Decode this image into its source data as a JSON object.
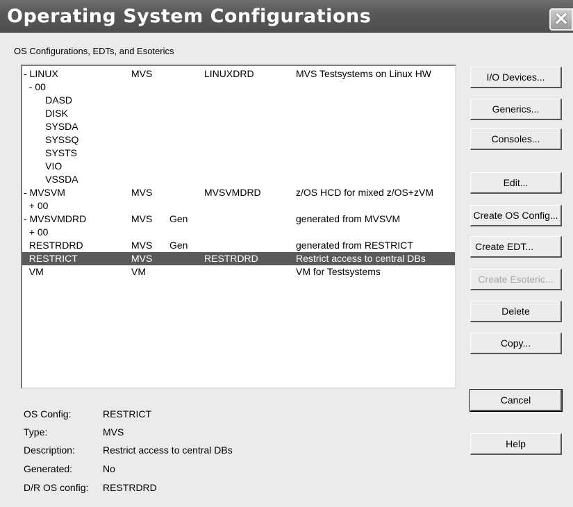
{
  "window": {
    "title": "Operating System Configurations",
    "close_glyph": "✕"
  },
  "group_label": "OS Configurations, EDTs, and Esoterics",
  "list": [
    {
      "name": "- LINUX",
      "type": "MVS",
      "gen": "",
      "dr": "LINUXDRD",
      "desc": "MVS Testsystems on Linux HW",
      "selected": false
    },
    {
      "name": "  - 00",
      "type": "",
      "gen": "",
      "dr": "",
      "desc": "",
      "selected": false
    },
    {
      "name": "        DASD",
      "type": "",
      "gen": "",
      "dr": "",
      "desc": "",
      "selected": false
    },
    {
      "name": "        DISK",
      "type": "",
      "gen": "",
      "dr": "",
      "desc": "",
      "selected": false
    },
    {
      "name": "        SYSDA",
      "type": "",
      "gen": "",
      "dr": "",
      "desc": "",
      "selected": false
    },
    {
      "name": "        SYSSQ",
      "type": "",
      "gen": "",
      "dr": "",
      "desc": "",
      "selected": false
    },
    {
      "name": "        SYSTS",
      "type": "",
      "gen": "",
      "dr": "",
      "desc": "",
      "selected": false
    },
    {
      "name": "        VIO",
      "type": "",
      "gen": "",
      "dr": "",
      "desc": "",
      "selected": false
    },
    {
      "name": "        VSSDA",
      "type": "",
      "gen": "",
      "dr": "",
      "desc": "",
      "selected": false
    },
    {
      "name": "- MVSVM",
      "type": "MVS",
      "gen": "",
      "dr": "MVSVMDRD",
      "desc": "z/OS HCD for mixed z/OS+zVM",
      "selected": false
    },
    {
      "name": "  + 00",
      "type": "",
      "gen": "",
      "dr": "",
      "desc": "",
      "selected": false
    },
    {
      "name": "- MVSVMDRD",
      "type": "MVS",
      "gen": "Gen",
      "dr": "",
      "desc": "generated from MVSVM",
      "selected": false
    },
    {
      "name": "  + 00",
      "type": "",
      "gen": "",
      "dr": "",
      "desc": "",
      "selected": false
    },
    {
      "name": "  RESTRDRD",
      "type": "MVS",
      "gen": "Gen",
      "dr": "",
      "desc": "generated from RESTRICT",
      "selected": false
    },
    {
      "name": "  RESTRICT",
      "type": "MVS",
      "gen": "",
      "dr": "RESTRDRD",
      "desc": "Restrict access to central DBs",
      "selected": true
    },
    {
      "name": "  VM",
      "type": "VM",
      "gen": "",
      "dr": "",
      "desc": "VM for Testsystems",
      "selected": false
    }
  ],
  "buttons": {
    "io_devices": "I/O Devices...",
    "generics": "Generics...",
    "consoles": "Consoles...",
    "edit": "Edit...",
    "create_os_config": "Create OS Config...",
    "create_edt": "Create EDT...",
    "create_esoteric": "Create Esoteric...",
    "delete": "Delete",
    "copy": "Copy...",
    "cancel": "Cancel",
    "help": "Help"
  },
  "details": {
    "os_config_label": "OS Config:",
    "os_config": "RESTRICT",
    "type_label": "Type:",
    "type": "MVS",
    "description_label": "Description:",
    "description": "Restrict access to central DBs",
    "generated_label": "Generated:",
    "generated": "No",
    "dr_label": "D/R OS config:",
    "dr": "RESTRDRD"
  },
  "colors": {
    "selection": "#5a5a5a",
    "titlebar": "#5a5a5a",
    "disabled_text": "#a8a8a8"
  }
}
